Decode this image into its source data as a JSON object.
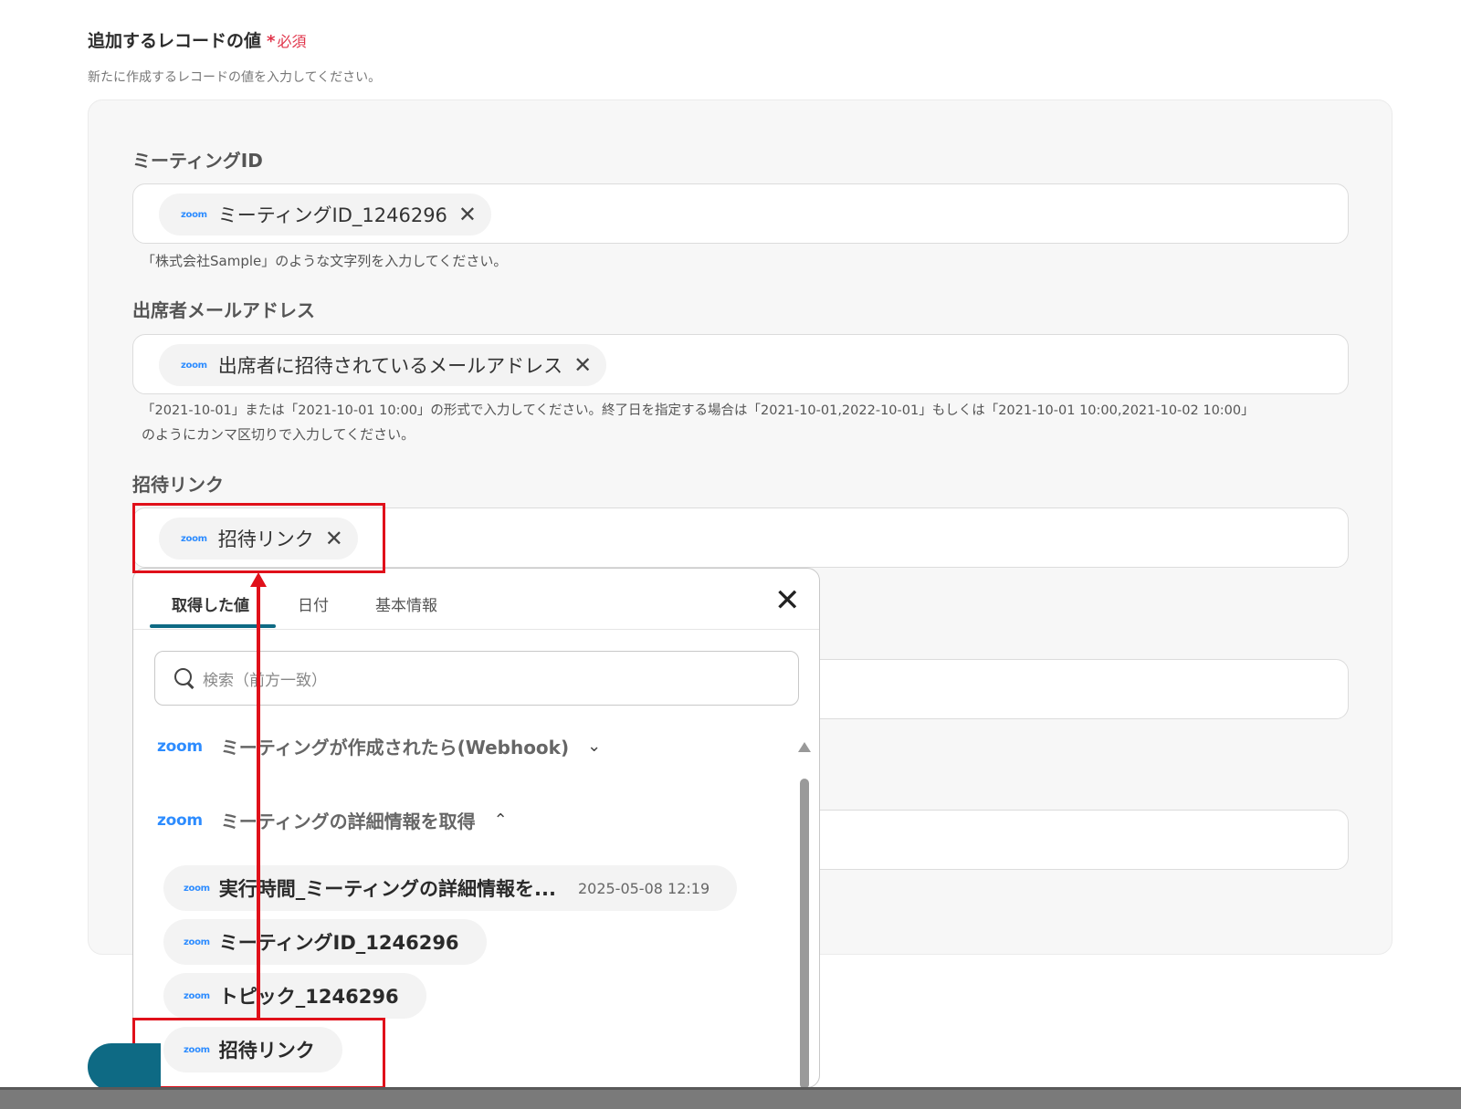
{
  "section": {
    "title": "追加するレコードの値",
    "required_star": "*",
    "required_label": "必須",
    "description": "新たに作成するレコードの値を入力してください。"
  },
  "fields": [
    {
      "label": "ミーティングID",
      "pill_logo": "zoom",
      "pill_text": "ミーティングID_1246296",
      "help": "「株式会社Sample」のような文字列を入力してください。"
    },
    {
      "label": "出席者メールアドレス",
      "pill_logo": "zoom",
      "pill_text": "出席者に招待されているメールアドレス",
      "help_line1": "「2021-10-01」または「2021-10-01 10:00」の形式で入力してください。終了日を指定する場合は「2021-10-01,2022-10-01」もしくは「2021-10-01 10:00,2021-10-02 10:00」",
      "help_line2": "のようにカンマ区切りで入力してください。"
    },
    {
      "label": "招待リンク",
      "pill_logo": "zoom",
      "pill_text": "招待リンク"
    }
  ],
  "close_glyph": "✕",
  "dropdown": {
    "tabs": [
      "取得した値",
      "日付",
      "基本情報"
    ],
    "active_tab": 0,
    "close_glyph": "✕",
    "search_placeholder": "検索（前方一致）",
    "groups": [
      {
        "logo": "zoom",
        "title": "ミーティングが作成されたら(Webhook)",
        "chevron": "⌄"
      },
      {
        "logo": "zoom",
        "title": "ミーティングの詳細情報を取得",
        "chevron": "⌃"
      }
    ],
    "items": [
      {
        "logo": "zoom",
        "label": "実行時間_ミーティングの詳細情報を...",
        "value": "2025-05-08 12:19"
      },
      {
        "logo": "zoom",
        "label": "ミーティングID_1246296"
      },
      {
        "logo": "zoom",
        "label": "トピック_1246296"
      },
      {
        "logo": "zoom",
        "label": "招待リンク"
      }
    ]
  },
  "colors": {
    "accent": "#0e6a84",
    "required": "#e0344a",
    "highlight": "#e0101a",
    "zoom": "#2d8cff"
  }
}
